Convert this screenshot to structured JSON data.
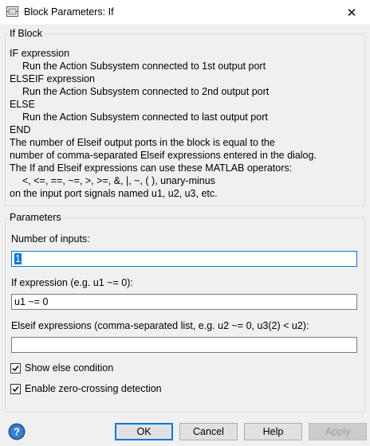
{
  "window": {
    "title": "Block Parameters: If",
    "close_glyph": "✕"
  },
  "if_block": {
    "legend": "If Block",
    "lines": [
      "IF expression",
      "Run the Action Subsystem connected to 1st output port",
      "ELSEIF expression",
      "Run the Action Subsystem connected to 2nd output port",
      "ELSE",
      "Run the Action Subsystem connected to last output port",
      "END",
      "The number of Elseif output ports in the block is equal to the",
      "number of comma-separated Elseif expressions entered in the dialog.",
      "The If and Elseif expressions can use these MATLAB operators:",
      "<, <=, ==, ~=, >, >=, &, |, ~, (  ), unary-minus",
      "on the input port signals named u1, u2, u3, etc."
    ]
  },
  "parameters": {
    "legend": "Parameters",
    "num_inputs_label": "Number of inputs:",
    "num_inputs_value": "1",
    "if_expr_label": "If expression (e.g. u1 ~= 0):",
    "if_expr_value": "u1 ~= 0",
    "elseif_label": "Elseif expressions (comma-separated list, e.g. u2 ~= 0, u3(2) < u2):",
    "elseif_value": "",
    "show_else_label": "Show else condition",
    "show_else_checked": true,
    "zero_crossing_label": "Enable zero-crossing detection",
    "zero_crossing_checked": true
  },
  "buttons": {
    "ok": "OK",
    "cancel": "Cancel",
    "help": "Help",
    "apply": "Apply"
  },
  "colors": {
    "accent": "#0078d7",
    "help_icon": "#2d6bb5"
  }
}
